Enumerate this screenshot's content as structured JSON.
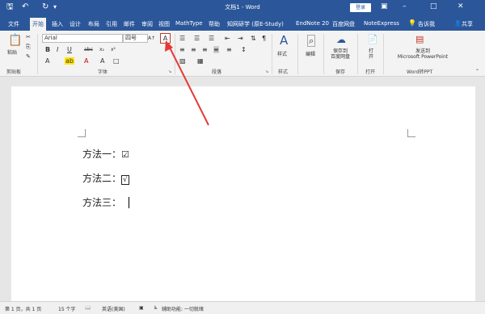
{
  "window": {
    "title": "文档1 - Word",
    "login_label": "登录"
  },
  "quick_access": {
    "save_icon": "save-icon",
    "undo_icon": "undo-icon",
    "redo_icon": "redo-icon"
  },
  "tabs": {
    "file": "文件",
    "home": "开始",
    "insert": "插入",
    "design": "设计",
    "layout": "布局",
    "references": "引用",
    "mailings": "邮件",
    "review": "审阅",
    "view": "视图",
    "mathtype": "MathType",
    "help": "帮助",
    "cnki": "知网研学 (原E-Study)",
    "endnote": "EndNote 20",
    "baidu": "百度网盘",
    "noteexpress": "NoteExpress",
    "tell_me": "告诉我",
    "share": "共享"
  },
  "ribbon": {
    "paste_label": "粘贴",
    "clipboard_label": "剪贴板",
    "font_name": "Arial",
    "font_size": "四号",
    "font_group_label": "字体",
    "paragraph_group_label": "段落",
    "styles_label": "样式",
    "styles_group_label": "样式",
    "editing_label": "编辑",
    "save_to_baidu_label": "保存到\n百度网盘",
    "save_group_label": "保存",
    "open_label": "打\n开",
    "open_group_label": "打开",
    "send_to_ppt_label": "发送到\nMicrosoft PowerPoint",
    "word_to_ppt_label": "Word转PPT"
  },
  "document": {
    "lines": [
      {
        "label": "方法一：",
        "mark": "☑"
      },
      {
        "label": "方法二：",
        "mark": "√"
      },
      {
        "label": "方法三：",
        "mark": ""
      }
    ]
  },
  "status": {
    "page": "第 1 页，共 1 页",
    "words": "15 个字",
    "language": "英语(美国)",
    "accessibility": "辅助功能: 一切就绪"
  },
  "colors": {
    "word_blue": "#2b579a",
    "annotation_red": "#e53935"
  }
}
